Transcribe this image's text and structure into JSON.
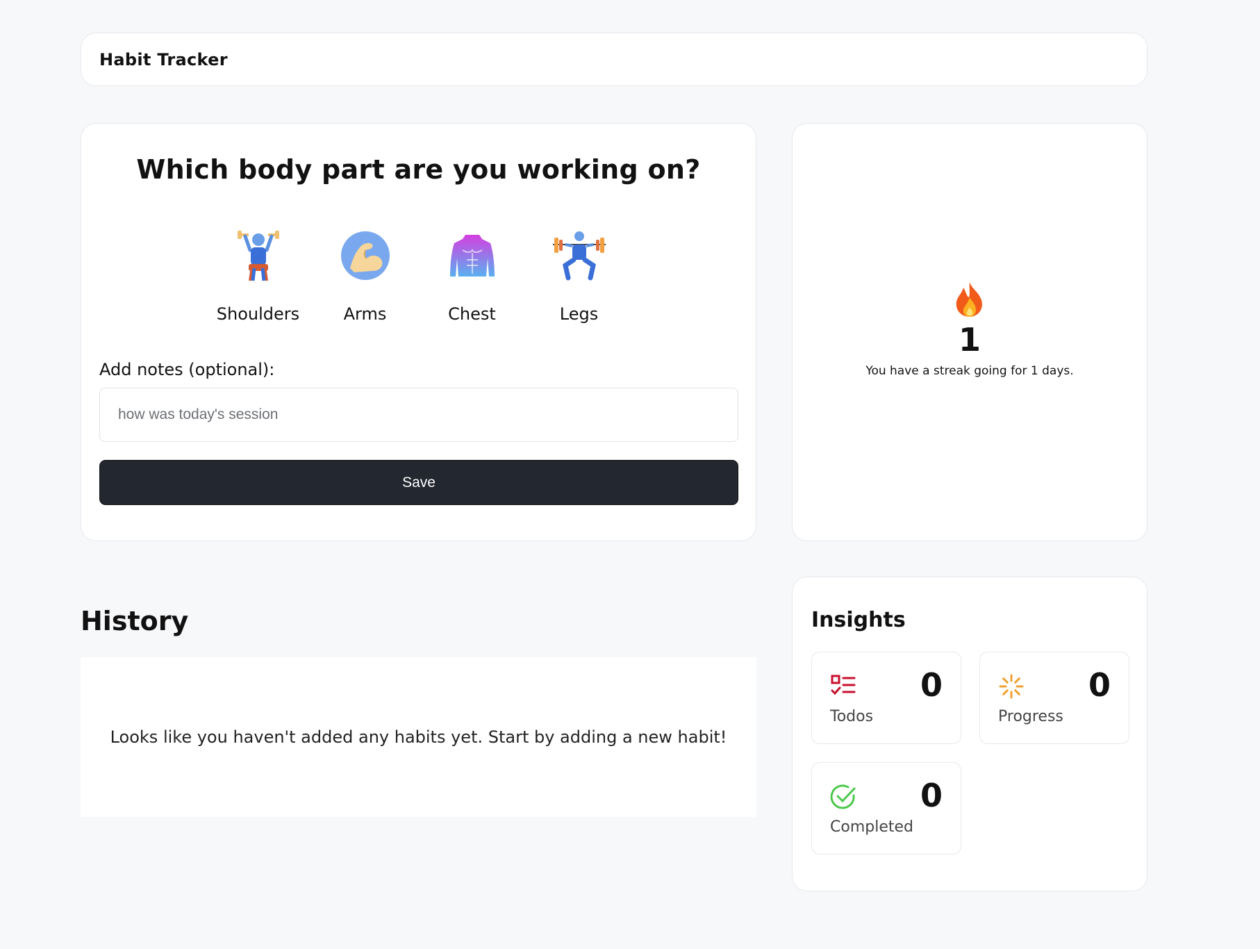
{
  "app": {
    "title": "Habit Tracker"
  },
  "picker": {
    "question": "Which body part are you working on?",
    "body_parts": [
      {
        "label": "Shoulders",
        "icon": "person-lifting-weights-icon"
      },
      {
        "label": "Arms",
        "icon": "flexed-biceps-icon"
      },
      {
        "label": "Chest",
        "icon": "torso-icon"
      },
      {
        "label": "Legs",
        "icon": "person-squatting-barbell-icon"
      }
    ],
    "notes_label": "Add notes (optional):",
    "notes_placeholder": "how was today's session",
    "notes_value": "",
    "save_label": "Save"
  },
  "streak": {
    "icon": "fire-icon",
    "count": "1",
    "message": "You have a streak going for 1 days."
  },
  "history": {
    "title": "History",
    "empty_message": "Looks like you haven't added any habits yet. Start by adding a new habit!"
  },
  "insights": {
    "title": "Insights",
    "stats": [
      {
        "label": "Todos",
        "value": "0",
        "icon": "checklist-icon",
        "color": "#c8102e"
      },
      {
        "label": "Progress",
        "value": "0",
        "icon": "loader-icon",
        "color": "#f0a030"
      },
      {
        "label": "Completed",
        "value": "0",
        "icon": "check-circle-icon",
        "color": "#4cc84a"
      }
    ]
  }
}
